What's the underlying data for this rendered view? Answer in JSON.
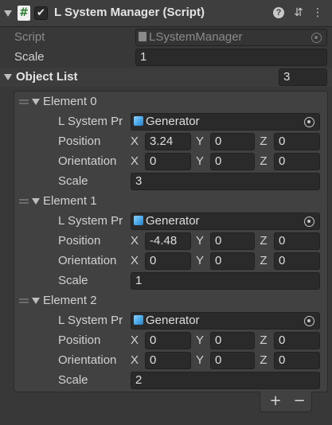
{
  "header": {
    "title": "L System Manager (Script)",
    "icons": [
      "fold-arrow-icon",
      "script-icon",
      "checkbox-icon",
      "help-icon",
      "preset-icon",
      "more-icon"
    ],
    "enabled": true
  },
  "script": {
    "label": "Script",
    "value": "LSystemManager"
  },
  "scale": {
    "label": "Scale",
    "value": "1"
  },
  "object_list": {
    "label": "Object List",
    "count": "3",
    "elements": [
      {
        "title": "Element 0",
        "lsystem_label": "L System Pr",
        "lsystem_value": "Generator",
        "position_label": "Position",
        "position": {
          "x": "3.24",
          "y": "0",
          "z": "0"
        },
        "orientation_label": "Orientation",
        "orientation": {
          "x": "0",
          "y": "0",
          "z": "0"
        },
        "scale_label": "Scale",
        "scale": "3"
      },
      {
        "title": "Element 1",
        "lsystem_label": "L System Pr",
        "lsystem_value": "Generator",
        "position_label": "Position",
        "position": {
          "x": "-4.48",
          "y": "0",
          "z": "0"
        },
        "orientation_label": "Orientation",
        "orientation": {
          "x": "0",
          "y": "0",
          "z": "0"
        },
        "scale_label": "Scale",
        "scale": "1"
      },
      {
        "title": "Element 2",
        "lsystem_label": "L System Pr",
        "lsystem_value": "Generator",
        "position_label": "Position",
        "position": {
          "x": "0",
          "y": "0",
          "z": "0"
        },
        "orientation_label": "Orientation",
        "orientation": {
          "x": "0",
          "y": "0",
          "z": "0"
        },
        "scale_label": "Scale",
        "scale": "2"
      }
    ]
  },
  "axes": {
    "x": "X",
    "y": "Y",
    "z": "Z"
  },
  "footer": {
    "add": "+",
    "remove": "−"
  },
  "colors": {
    "background": "#383838",
    "field": "#2a2a2a",
    "asset_icon": "#4aa8e8"
  }
}
